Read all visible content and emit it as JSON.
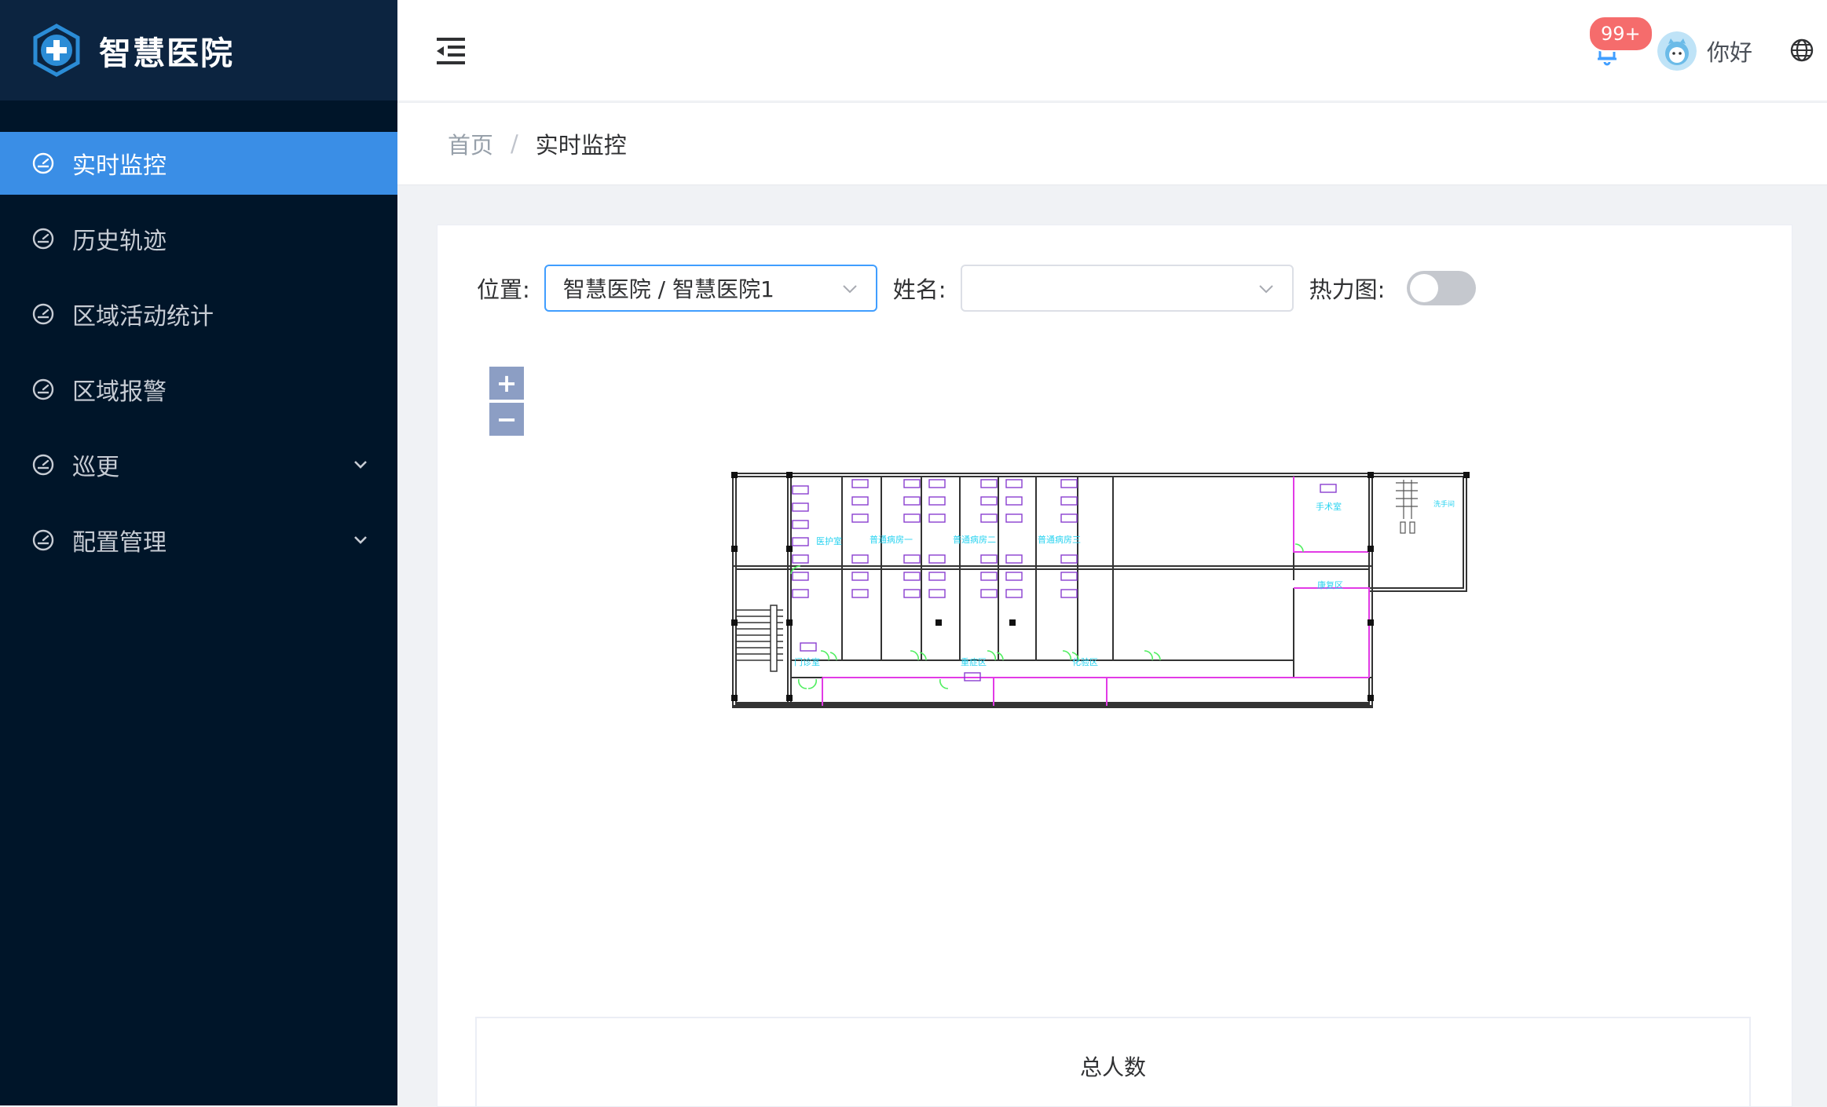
{
  "app": {
    "title": "智慧医院"
  },
  "sidebar": {
    "items": [
      {
        "label": "实时监控",
        "icon": "dashboard-icon",
        "active": true
      },
      {
        "label": "历史轨迹",
        "icon": "dashboard-icon"
      },
      {
        "label": "区域活动统计",
        "icon": "dashboard-icon"
      },
      {
        "label": "区域报警",
        "icon": "dashboard-icon"
      },
      {
        "label": "巡更",
        "icon": "dashboard-icon",
        "expandable": true
      },
      {
        "label": "配置管理",
        "icon": "dashboard-icon",
        "expandable": true
      }
    ]
  },
  "header": {
    "notification_count": "99+",
    "greeting": "你好"
  },
  "breadcrumb": {
    "home": "首页",
    "separator": "/",
    "current": "实时监控"
  },
  "filters": {
    "location_label": "位置:",
    "location_value": "智慧医院 / 智慧医院1",
    "name_label": "姓名:",
    "name_value": "",
    "heatmap_label": "热力图:",
    "heatmap_on": false
  },
  "map": {
    "zoom_in": "+",
    "zoom_out": "−",
    "rooms": {
      "nurse": "医护室",
      "ward1": "普通病房一",
      "ward2": "普通病房二",
      "ward3": "普通病房三",
      "surgery": "手术室",
      "wash": "洗手间",
      "rehab": "康复区",
      "clinic": "门诊室",
      "critical": "重症区",
      "lab": "化验区"
    }
  },
  "stats": {
    "total_label": "总人数"
  },
  "colors": {
    "sidebar_bg": "#001529",
    "active": "#3a8ee6",
    "badge": "#f56c6c",
    "room_label": "#29d3f0",
    "partition": "#e23be6"
  }
}
